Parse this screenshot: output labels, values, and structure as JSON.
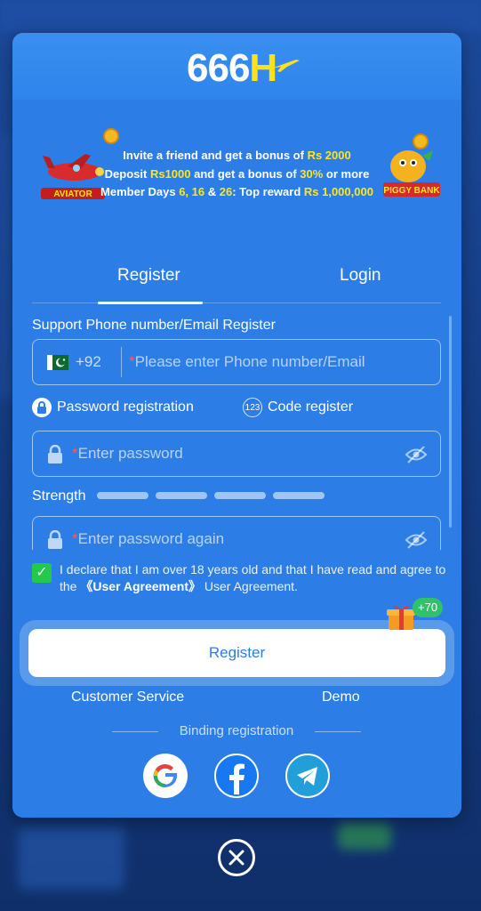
{
  "brand": {
    "logo_text_main": "666",
    "logo_text_accent": "H"
  },
  "promo": {
    "line1_pre": "Invite a friend and get a bonus of ",
    "line1_hl": "Rs 2000",
    "line2_pre": "Deposit ",
    "line2_hl1": "Rs1000",
    "line2_mid": " and get a bonus of ",
    "line2_hl2": "30%",
    "line2_post": " or more",
    "line3_pre": "Member Days ",
    "line3_hl1": "6, 16",
    "line3_mid": " & ",
    "line3_hl2": "26",
    "line3_post2": ": Top reward ",
    "line3_hl3": "Rs 1,000,000",
    "aviator_label": "AVIATOR",
    "piggy_label": "PIGGY BANK"
  },
  "tabs": {
    "register": "Register",
    "login": "Login"
  },
  "form": {
    "support_label": "Support Phone number/Email Register",
    "country_code": "+92",
    "phone_placeholder": "Please enter Phone number/Email",
    "mode_password": "Password registration",
    "mode_code": "Code register",
    "code_icon_text": "123",
    "password_placeholder": "Enter password",
    "strength_label": "Strength",
    "password_again_placeholder": "Enter password again",
    "required_mark": "*"
  },
  "agreement": {
    "text_pre": "I declare that I am over 18 years old and that I have read and agree to the ",
    "link": "《User Agreement》",
    "text_post": " User Agreement.",
    "checked": true
  },
  "actions": {
    "register_button": "Register",
    "bonus_badge": "+70",
    "customer_service": "Customer Service",
    "demo": "Demo",
    "binding_label": "Binding registration"
  },
  "colors": {
    "modal_bg": "#2c7ee6",
    "highlight": "#ffe51f",
    "check_green": "#23c94a"
  }
}
